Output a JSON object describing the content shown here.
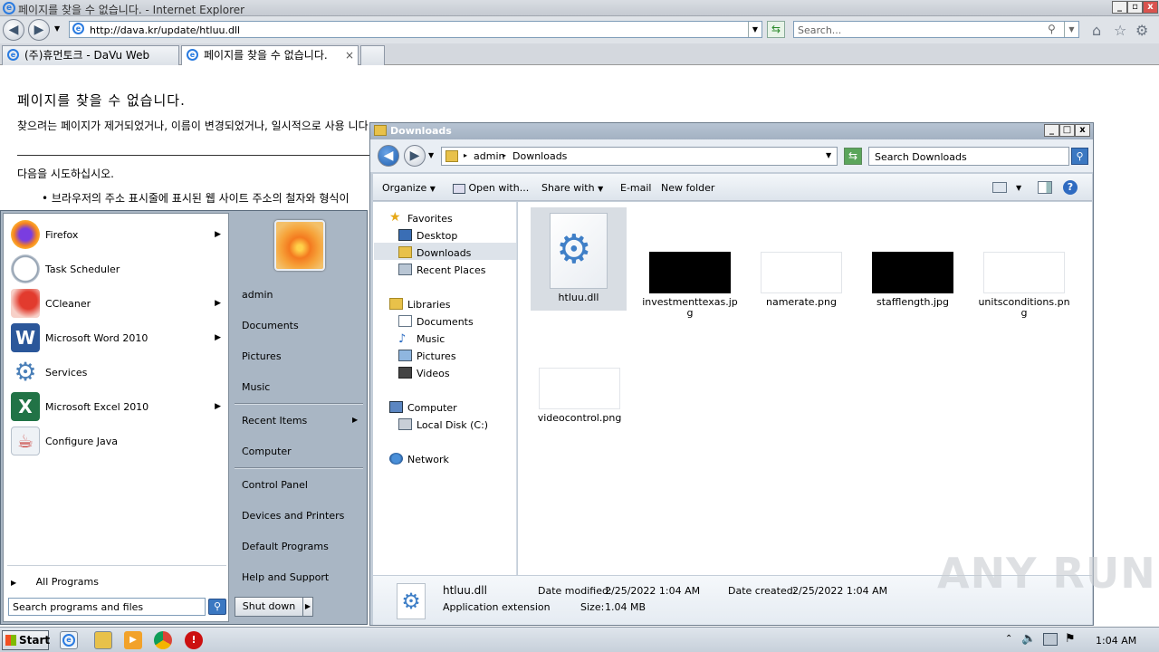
{
  "ie": {
    "title": "페이지를 찾을 수 없습니다. - Internet Explorer",
    "url": "http://dava.kr/update/htluu.dll",
    "search_placeholder": "Search...",
    "tabs": [
      {
        "label": "(주)휴먼토크 - DaVu Web Secu..."
      },
      {
        "label": "페이지를 찾을 수 없습니다."
      }
    ],
    "tab_close": "×",
    "page": {
      "heading": "페이지를 찾을 수 없습니다.",
      "desc": "찾으려는 페이지가 제거되었거나, 이름이 변경되었거나, 일시적으로 사용 니다.",
      "try": "다음을 시도하십시오.",
      "bullet": "• 브라우저의 주소 표시줄에 표시된 웹 사이트 주소의 철자와 형식이"
    }
  },
  "start_menu": {
    "programs": [
      {
        "label": "Firefox",
        "icon": "firefox-icon",
        "has_submenu": true
      },
      {
        "label": "Task Scheduler",
        "icon": "clock-icon",
        "has_submenu": false
      },
      {
        "label": "CCleaner",
        "icon": "ccleaner-icon",
        "has_submenu": true
      },
      {
        "label": "Microsoft Word 2010",
        "icon": "word-icon",
        "has_submenu": true
      },
      {
        "label": "Services",
        "icon": "gears-icon",
        "has_submenu": false
      },
      {
        "label": "Microsoft Excel 2010",
        "icon": "excel-icon",
        "has_submenu": true
      },
      {
        "label": "Configure Java",
        "icon": "java-icon",
        "has_submenu": false
      }
    ],
    "all_programs": "All Programs",
    "search_placeholder": "Search programs and files",
    "right": {
      "user": "admin",
      "documents": "Documents",
      "pictures": "Pictures",
      "music": "Music",
      "recent_items": "Recent Items",
      "computer": "Computer",
      "control_panel": "Control Panel",
      "devices_printers": "Devices and Printers",
      "default_programs": "Default Programs",
      "help_support": "Help and Support"
    },
    "shutdown": "Shut down"
  },
  "explorer": {
    "title": "Downloads",
    "breadcrumb": [
      "admin",
      "Downloads"
    ],
    "search_placeholder": "Search Downloads",
    "toolbar": {
      "organize": "Organize",
      "open_with": "Open with...",
      "share_with": "Share with",
      "email": "E-mail",
      "new_folder": "New folder"
    },
    "nav": {
      "favorites": "Favorites",
      "desktop": "Desktop",
      "downloads": "Downloads",
      "recent_places": "Recent Places",
      "libraries": "Libraries",
      "documents": "Documents",
      "music": "Music",
      "pictures": "Pictures",
      "videos": "Videos",
      "computer": "Computer",
      "local_disk": "Local Disk (C:)",
      "network": "Network"
    },
    "files": [
      {
        "name": "htluu.dll",
        "kind": "dll",
        "selected": true
      },
      {
        "name": "investmenttexas.jpg",
        "kind": "black"
      },
      {
        "name": "namerate.png",
        "kind": "white"
      },
      {
        "name": "stafflength.jpg",
        "kind": "black"
      },
      {
        "name": "unitsconditions.png",
        "kind": "white"
      },
      {
        "name": "videocontrol.png",
        "kind": "white"
      }
    ],
    "details": {
      "name": "htluu.dll",
      "type": "Application extension",
      "modified_label": "Date modified:",
      "modified": "2/25/2022 1:04 AM",
      "size_label": "Size:",
      "size": "1.04 MB",
      "created_label": "Date created:",
      "created": "2/25/2022 1:04 AM"
    }
  },
  "taskbar": {
    "start": "Start",
    "clock": "1:04 AM"
  },
  "watermark": "ANY RUN"
}
